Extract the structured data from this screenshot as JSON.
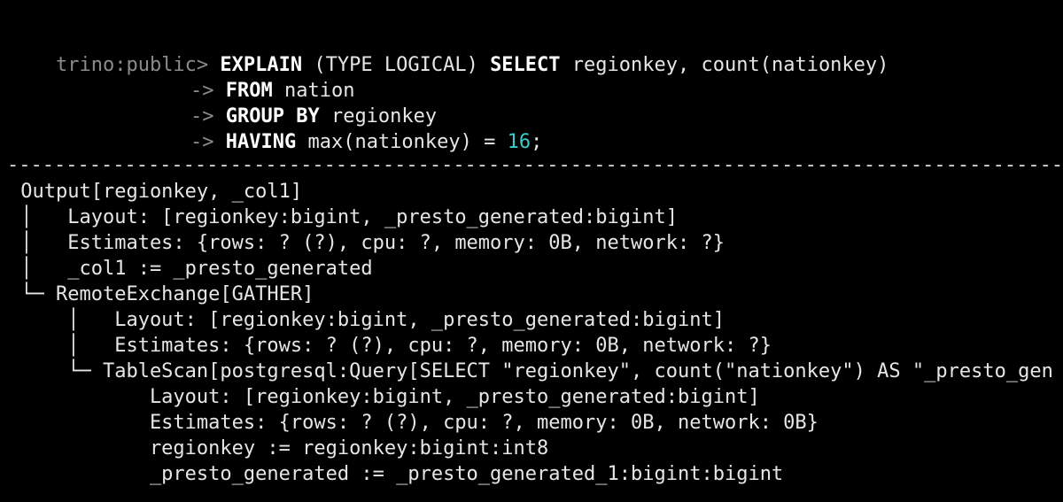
{
  "terminal": {
    "prompt": "trino:public>",
    "continuation": "->",
    "query_lines": [
      [
        {
          "t": "kw",
          "v": "EXPLAIN"
        },
        {
          "t": "plain",
          "v": " (TYPE LOGICAL) "
        },
        {
          "t": "kw",
          "v": "SELECT"
        },
        {
          "t": "plain",
          "v": " regionkey, count(nationkey)"
        }
      ],
      [
        {
          "t": "kw",
          "v": "FROM"
        },
        {
          "t": "plain",
          "v": " nation"
        }
      ],
      [
        {
          "t": "kw",
          "v": "GROUP BY"
        },
        {
          "t": "plain",
          "v": " regionkey"
        }
      ],
      [
        {
          "t": "kw",
          "v": "HAVING"
        },
        {
          "t": "plain",
          "v": " max(nationkey) = "
        },
        {
          "t": "num",
          "v": "16"
        },
        {
          "t": "plain",
          "v": ";"
        }
      ]
    ],
    "separator": "--------------------------------------------------------------------------------------------------------------",
    "plan_lines": [
      " Output[regionkey, _col1]",
      " │   Layout: [regionkey:bigint, _presto_generated:bigint]",
      " │   Estimates: {rows: ? (?), cpu: ?, memory: 0B, network: ?}",
      " │   _col1 := _presto_generated",
      " └─ RemoteExchange[GATHER]",
      "     │   Layout: [regionkey:bigint, _presto_generated:bigint]",
      "     │   Estimates: {rows: ? (?), cpu: ?, memory: 0B, network: ?}",
      "     └─ TableScan[postgresql:Query[SELECT \"regionkey\", count(\"nationkey\") AS \"_presto_gen",
      "            Layout: [regionkey:bigint, _presto_generated:bigint]",
      "            Estimates: {rows: ? (?), cpu: ?, memory: 0B, network: 0B}",
      "            regionkey := regionkey:bigint:int8",
      "            _presto_generated := _presto_generated_1:bigint:bigint"
    ]
  }
}
